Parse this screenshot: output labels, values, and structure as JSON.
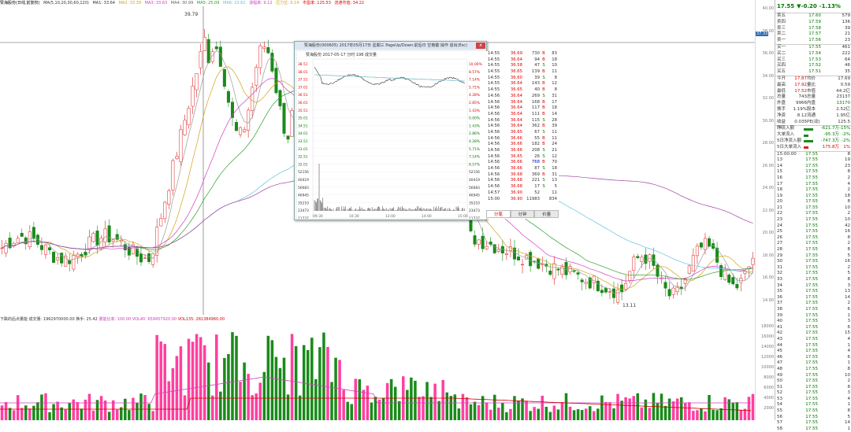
{
  "header": {
    "stock_title": "赞海股份(日线,前复权)",
    "ma_params": "MA(5,10,20,30,60,120)",
    "ma1": "MA1: 33.64",
    "ma2": "MA2: 33.39",
    "ma3": "MA3: 33.63",
    "ma4": "MA4: 30.99",
    "ma5": "MA5: 25.09",
    "ma6": "MA6: 23.62",
    "zhangfu": "涨幅率: 9.12",
    "yaoli": "压力位: 0.14",
    "shichang": "市盈率: 125.53",
    "tongji": "流通市值: 34.22"
  },
  "crosshair_price": "37.33",
  "main_axis": [
    "40.00",
    "38.00",
    "36.00",
    "34.00",
    "32.00",
    "30.00",
    "28.00",
    "26.00",
    "24.00",
    "22.00",
    "20.00",
    "18.00",
    "16.00",
    "14.00"
  ],
  "annotations": {
    "high": "39.79",
    "low": "13.11"
  },
  "volume_header": {
    "title": "下跌的后点量能",
    "vol": "成交量: 1962970000.00",
    "turnover": "换手: 25.42",
    "ratio": "量能比率: 100.00",
    "vol40": "VOL40: 659457920.00",
    "vol135": "VOL135: 281384960.00"
  },
  "vol_axis": [
    "18000",
    "16000",
    "14000",
    "12000",
    "10000",
    "8000",
    "6000",
    "4000",
    "2000"
  ],
  "popup": {
    "title": "赞海股份(000605) 2017年05月17日 星期三 PageUp/Down:前后日 空格键:操作 退出(Esc)",
    "close": "x",
    "subtitle": "赞海股份 2017-05-17 分时 198 成交量",
    "left_axis": [
      "38.51",
      "38.01",
      "37.51",
      "37.01",
      "36.51",
      "36.01",
      "35.51",
      "35.01",
      "34.51",
      "34.01",
      "33.51",
      "33.01",
      "32.51",
      "32.01",
      "52156",
      "40419",
      "56683",
      "46945",
      "35210",
      "23473",
      "11737"
    ],
    "right_axis": [
      "10.00%",
      "8.57%",
      "7.14%",
      "5.71%",
      "4.28%",
      "2.85%",
      "1.43%",
      "0.00%",
      "1.43%",
      "2.86%",
      "4.28%",
      "5.71%",
      "7.14%",
      "8.57%",
      "52156",
      "40419",
      "56683",
      "46945",
      "35210",
      "23473",
      "11737"
    ],
    "time_axis": [
      "09:30",
      "10:30",
      "13:00",
      "14:00",
      "15:00"
    ],
    "trades": [
      [
        "14:55",
        "36.69",
        "730",
        "B",
        "83"
      ],
      [
        "14:55",
        "36.64",
        "94",
        "B",
        "18"
      ],
      [
        "14:55",
        "36.58",
        "47",
        "S",
        "10"
      ],
      [
        "14:55",
        "36.65",
        "139",
        "B",
        "11"
      ],
      [
        "14:55",
        "36.60",
        "39",
        "S",
        "8"
      ],
      [
        "14:55",
        "36.64",
        "143",
        "B",
        "12"
      ],
      [
        "14:55",
        "36.65",
        "40",
        "B",
        "8"
      ],
      [
        "14:56",
        "36.64",
        "269",
        "S",
        "31"
      ],
      [
        "14:56",
        "36.64",
        "168",
        "B",
        "17"
      ],
      [
        "14:56",
        "36.64",
        "117",
        "B",
        "18"
      ],
      [
        "14:56",
        "36.64",
        "111",
        "B",
        "14"
      ],
      [
        "14:56",
        "36.64",
        "115",
        "S",
        "28"
      ],
      [
        "14:56",
        "36.64",
        "362",
        "B",
        "39"
      ],
      [
        "14:56",
        "36.65",
        "67",
        "S",
        "11"
      ],
      [
        "14:56",
        "36.66",
        "55",
        "B",
        "11"
      ],
      [
        "14:56",
        "36.66",
        "182",
        "B",
        "24"
      ],
      [
        "14:56",
        "36.66",
        "208",
        "S",
        "21"
      ],
      [
        "14:56",
        "36.65",
        "26",
        "S",
        "12"
      ],
      [
        "14:56",
        "36.66",
        "768",
        "B",
        "70"
      ],
      [
        "14:56",
        "36.66",
        "87",
        "S",
        "18"
      ],
      [
        "14:56",
        "36.68",
        "369",
        "B",
        "31"
      ],
      [
        "14:56",
        "36.68",
        "221",
        "S",
        "13"
      ],
      [
        "14:56",
        "36.68",
        "17",
        "S",
        "5"
      ],
      [
        "14:57",
        "36.90",
        "52",
        "",
        "11"
      ],
      [
        "15:00",
        "36.90",
        "11983",
        "",
        "834"
      ]
    ],
    "tabs": [
      "分笔",
      "分钟",
      "价量"
    ]
  },
  "quote": {
    "price": "17.55",
    "change": "▼-0.20",
    "pct": "-1.13%",
    "sells": [
      [
        "卖五",
        "17.60",
        "579"
      ],
      [
        "卖四",
        "17.59",
        "136"
      ],
      [
        "卖三",
        "17.58",
        "39"
      ],
      [
        "卖二",
        "17.57",
        "21"
      ],
      [
        "卖一",
        "17.56",
        "23"
      ]
    ],
    "buys": [
      [
        "买一",
        "17.55",
        "461"
      ],
      [
        "买二",
        "17.54",
        "222"
      ],
      [
        "买三",
        "17.53",
        "64"
      ],
      [
        "买四",
        "17.52",
        "46"
      ],
      [
        "买五",
        "17.51",
        "35"
      ]
    ],
    "stats": [
      [
        "今开",
        "17.87",
        "均价",
        "17.69"
      ],
      [
        "最高",
        "17.92",
        "量比",
        "0.59"
      ],
      [
        "最低",
        "17.52",
        "市值",
        "44.2亿"
      ],
      [
        "总量",
        "743",
        "总量",
        "23137"
      ],
      [
        "外盘",
        "9966",
        "内盘",
        "13170"
      ],
      [
        "换手",
        "1.19%",
        "股本",
        "2.52亿"
      ],
      [
        "净资",
        "8.12",
        "流通",
        "1.95亿"
      ],
      [
        "收益(-)",
        "0.035",
        "PE(动)",
        "125.5"
      ]
    ],
    "flows": [
      [
        "净流入额",
        "",
        "-621.7万",
        "-15%"
      ],
      [
        "大单流入",
        "",
        "-95.3万",
        "-2%"
      ],
      [
        "5日净流入额",
        "",
        "-747.3万",
        "-2%"
      ],
      [
        "5日大单流入",
        "",
        "175.8万",
        "1%"
      ]
    ],
    "ticks": [
      [
        "15:00:00",
        "17.55",
        "8"
      ],
      [
        "13",
        "17.55",
        "19"
      ],
      [
        "14",
        "17.55",
        "23"
      ],
      [
        "15",
        "17.55",
        "8"
      ],
      [
        "16",
        "17.55",
        "2"
      ],
      [
        "17",
        "17.55",
        "4"
      ],
      [
        "18",
        "17.55",
        "2"
      ],
      [
        "19",
        "17.55",
        "18"
      ],
      [
        "20",
        "17.55",
        "8"
      ],
      [
        "21",
        "17.55",
        "10"
      ],
      [
        "22",
        "17.55",
        "2"
      ],
      [
        "23",
        "17.55",
        "10"
      ],
      [
        "24",
        "17.55",
        "42"
      ],
      [
        "25",
        "17.55",
        "16"
      ],
      [
        "26",
        "17.55",
        "8"
      ],
      [
        "27",
        "17.55",
        "2"
      ],
      [
        "28",
        "17.55",
        "8"
      ],
      [
        "29",
        "17.55",
        "5"
      ],
      [
        "30",
        "17.55",
        "16"
      ],
      [
        "31",
        "17.55",
        "2"
      ],
      [
        "32",
        "17.55",
        "5"
      ],
      [
        "33",
        "17.55",
        "8"
      ],
      [
        "34",
        "17.55",
        "3"
      ],
      [
        "35",
        "17.55",
        "13"
      ],
      [
        "36",
        "17.55",
        "14"
      ],
      [
        "37",
        "17.55",
        "2"
      ],
      [
        "38",
        "17.55",
        "6"
      ],
      [
        "39",
        "17.55",
        "1"
      ],
      [
        "40",
        "17.55",
        "3"
      ],
      [
        "41",
        "17.55",
        "6"
      ],
      [
        "42",
        "17.55",
        "15"
      ],
      [
        "43",
        "17.55",
        "4"
      ],
      [
        "44",
        "17.55",
        "1"
      ],
      [
        "45",
        "17.55",
        "4"
      ],
      [
        "46",
        "17.55",
        "6"
      ],
      [
        "47",
        "17.55",
        "1"
      ],
      [
        "48",
        "17.55",
        "8"
      ],
      [
        "49",
        "17.55",
        "10"
      ],
      [
        "50",
        "17.55",
        "2"
      ],
      [
        "51",
        "17.55",
        "8"
      ],
      [
        "52",
        "17.55",
        "3"
      ],
      [
        "53",
        "17.55",
        "4"
      ],
      [
        "54",
        "17.55",
        "1"
      ],
      [
        "55",
        "17.55",
        "8"
      ],
      [
        "56",
        "17.55",
        "5"
      ],
      [
        "57",
        "17.55",
        "14"
      ],
      [
        "58",
        "17.55",
        "1"
      ]
    ]
  },
  "colors": {
    "up": "#e02020",
    "down": "#1a8a1a",
    "ma_white": "#999999",
    "ma_yellow": "#d4a017",
    "ma_pink": "#d040c0",
    "ma_green": "#2aa02a",
    "ma_blue": "#60c0e0",
    "ma_purple": "#a040a0"
  }
}
